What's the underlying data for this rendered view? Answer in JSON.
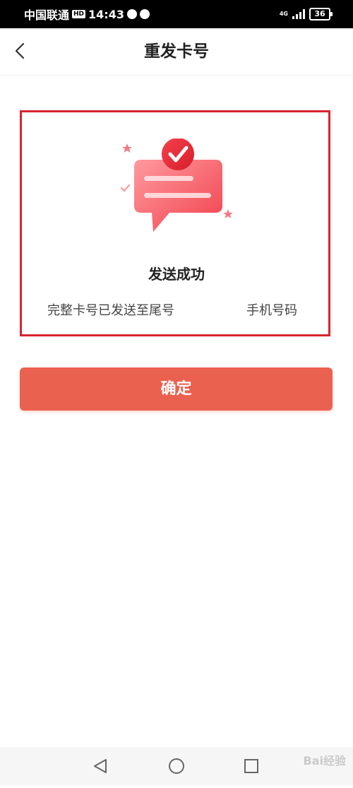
{
  "status_bar": {
    "carrier": "中国联通",
    "hd": "HD",
    "time": "14:43",
    "network": "4G",
    "battery": "36"
  },
  "nav": {
    "title": "重发卡号",
    "back_icon": "chevron-left-icon"
  },
  "result": {
    "title": "发送成功",
    "desc_prefix": "完整卡号已发送至尾号",
    "desc_suffix": "手机号码",
    "icon": "message-check-icon"
  },
  "actions": {
    "confirm_label": "确定"
  },
  "system_nav": {
    "back": "triangle-back-icon",
    "home": "circle-home-icon",
    "recents": "square-recents-icon"
  },
  "watermark": "Bai经验",
  "colors": {
    "accent": "#eb6150",
    "highlight_border": "#d6242f",
    "illustration_red": "#f0414c"
  }
}
